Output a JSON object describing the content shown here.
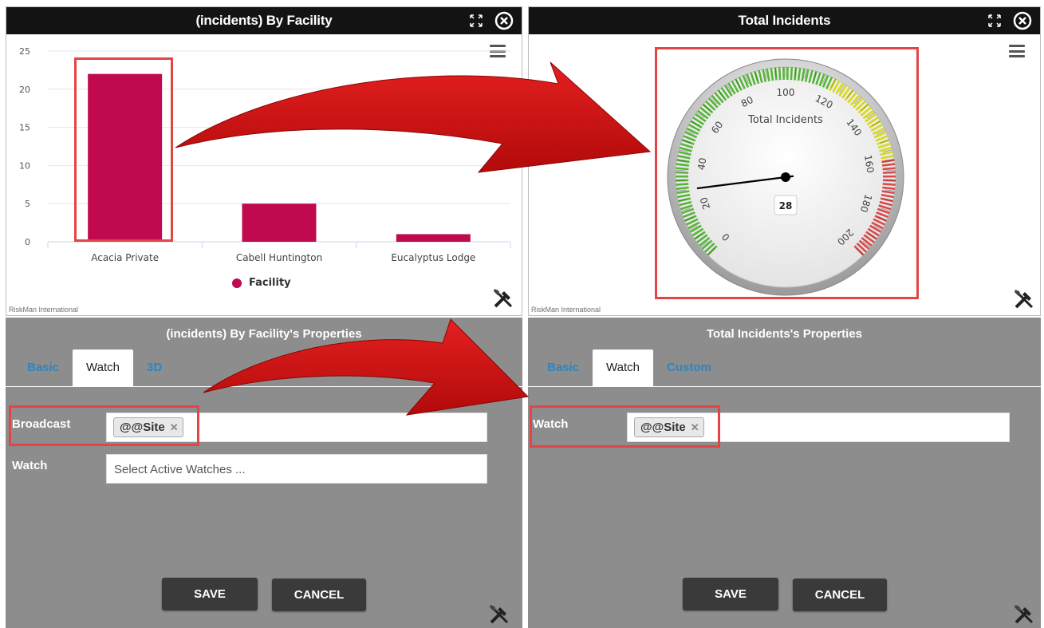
{
  "panels": {
    "chart": {
      "title": "(incidents) By Facility",
      "legend_label": "Facility",
      "brand": "RiskMan International"
    },
    "gauge": {
      "title": "Total Incidents",
      "label": "Total Incidents",
      "value_text": "28",
      "brand": "RiskMan International"
    },
    "chart_props": {
      "title": "(incidents) By Facility's Properties",
      "tabs": [
        "Basic",
        "Watch",
        "3D"
      ],
      "active_tab": "Watch",
      "broadcast_label": "Broadcast",
      "broadcast_tag": "@@Site",
      "watch_label": "Watch",
      "watch_placeholder": "Select Active Watches ...",
      "save": "SAVE",
      "cancel": "CANCEL"
    },
    "gauge_props": {
      "title": "Total Incidents's Properties",
      "tabs": [
        "Basic",
        "Watch",
        "Custom"
      ],
      "active_tab": "Watch",
      "watch_label": "Watch",
      "watch_tag": "@@Site",
      "save": "SAVE",
      "cancel": "CANCEL"
    }
  },
  "colors": {
    "bar": "#c0094f",
    "gauge_green": "#58b43a",
    "gauge_yellow": "#d8d81e",
    "gauge_red": "#d84a4a",
    "highlight": "#e34545",
    "arrow": "#d21111"
  },
  "icons": [
    "expand-icon",
    "close-circle-icon",
    "hamburger-menu-icon",
    "tools-icon",
    "tag-remove-icon"
  ],
  "chart_data": [
    {
      "type": "bar",
      "categories": [
        "Acacia Private",
        "Cabell Huntington",
        "Eucalyptus Lodge"
      ],
      "series": [
        {
          "name": "Facility",
          "values": [
            22,
            5,
            1
          ]
        }
      ],
      "title": "(incidents) By Facility",
      "ylim": [
        0,
        25
      ],
      "yticks": [
        0,
        5,
        10,
        15,
        20,
        25
      ],
      "legend": "bottom",
      "grid": true
    },
    {
      "type": "gauge",
      "title": "Total Incidents",
      "value": 28,
      "range": [
        0,
        200
      ],
      "ticks": [
        0,
        20,
        40,
        60,
        80,
        100,
        120,
        140,
        160,
        180,
        200
      ],
      "bands": [
        {
          "from": 0,
          "to": 120,
          "color": "#58b43a"
        },
        {
          "from": 120,
          "to": 160,
          "color": "#d8d81e"
        },
        {
          "from": 160,
          "to": 200,
          "color": "#d84a4a"
        }
      ]
    }
  ]
}
